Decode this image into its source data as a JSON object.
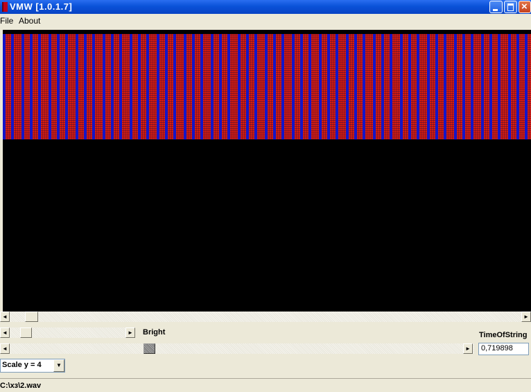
{
  "window": {
    "title": "VMW [1.0.1.7]"
  },
  "menu": {
    "file": "File",
    "about": "About"
  },
  "colors": {
    "spectrogram_red": "#d81e10",
    "spectrogram_blue": "#1414c8",
    "canvas_bg": "#000000"
  },
  "controls": {
    "bright_label": "Bright",
    "time_label": "TimeOfString",
    "time_value": "0,719898",
    "scale_value": "Scale y = 4"
  },
  "status": {
    "path": "C:\\хз\\2.wav"
  },
  "icons": {
    "left": "◄",
    "right": "►",
    "down": "▼",
    "close": "×"
  }
}
